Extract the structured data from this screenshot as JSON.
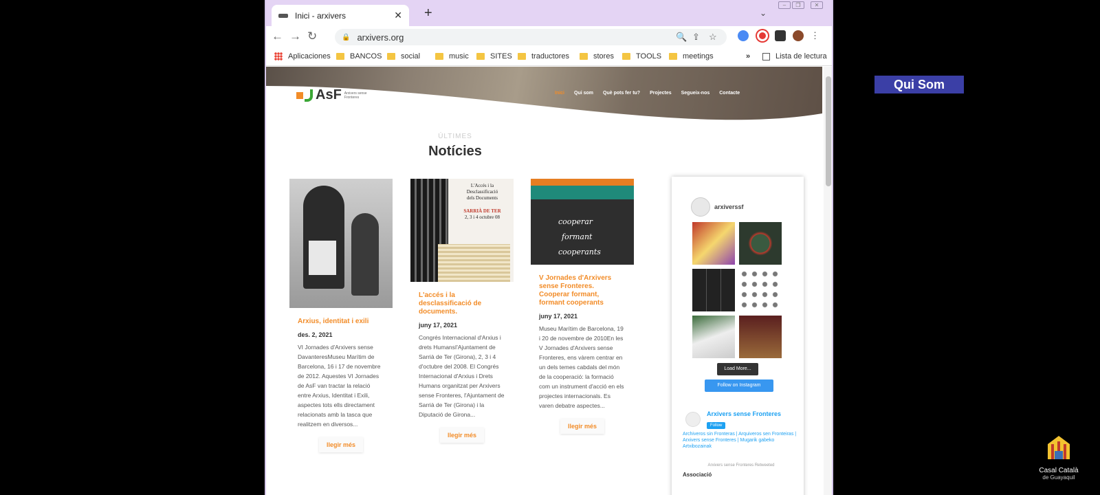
{
  "browser": {
    "tab_title": "Inici - arxivers",
    "new_tab_icon": "plus-icon",
    "url": "arxivers.org",
    "bookmarks": [
      "Aplicaciones",
      "BANCOS",
      "social",
      "music",
      "SITES",
      "traductores",
      "stores",
      "TOOLS",
      "meetings"
    ],
    "reading_list": "Lista de lectura",
    "overflow": "»"
  },
  "site": {
    "logo_text": "AsF",
    "logo_sub": "Arxivers sense Fronteres",
    "nav": [
      "Inici",
      "Qui som",
      "Què pots fer tu?",
      "Projectes",
      "Segueix-nos",
      "Contacte"
    ],
    "eyebrow": "ÚLTIMES",
    "section_title": "Notícies",
    "cards": [
      {
        "title": "Arxius, identitat i exili",
        "date": "des. 2, 2021",
        "excerpt": "VI Jornades d'Arxivers sense DavanteresMuseu Marítim de Barcelona, 16 i 17 de novembre de 2012. Aquestes VI Jornades de AsF van tractar la relació entre Arxius, Identitat i Exili, aspectes tots ells directament relacionats amb la tasca que realitzem en diversos...",
        "more": "llegir més"
      },
      {
        "title": "L'accés i la desclassificació de documents.",
        "date": "juny 17, 2021",
        "excerpt": "Congrés Internacional d'Arxius i drets HumansI'Ajuntament de Sarrià de Ter (Girona), 2, 3 i 4 d'octubre del 2008. El Congrés Internacional d'Arxius i Drets Humans organitzat per Arxivers sense Fronteres, l'Ajuntament de Sarrià de Ter (Girona) i la Diputació de Girona...",
        "more": "llegir més"
      },
      {
        "title": "V Jornades d'Arxivers sense Fronteres. Cooperar formant, formant cooperants",
        "date": "juny 17, 2021",
        "excerpt": "Museu Marítim de Barcelona, 19 i 20 de novembre de 2010En les V Jornades d'Arxivers sense Fronteres, ens vàrem centrar en un dels temes cabdals del món de la cooperació: la formació com un instrument d'acció en els projectes internacionals. Es varen debatre aspectes...",
        "more": "llegir més"
      }
    ],
    "card2_image_text": [
      "L'Accés i la",
      "Desclassificació",
      "dels Documents",
      "SARRIÀ DE TER",
      "2, 3 i 4 octubre 08"
    ],
    "card3_image_text": [
      "cooperar",
      "formant",
      "cooperants"
    ],
    "instagram": {
      "user": "arxiverssf",
      "load_more": "Load More...",
      "follow": "Follow on Instagram"
    },
    "twitter": {
      "name": "Arxivers sense Fronteres",
      "follow": "Follow",
      "desc": "Archiveros sin Fronteras | Arquiveros sen Fronteiras | Arxivers sense Fronteres | Mugarik gabeko Artxibozainak",
      "retweeted": "Arxivers sense Fronteres Retweeted",
      "next": "Associació"
    }
  },
  "overlay": {
    "label": "Qui Som",
    "brand_line1": "Casal Català",
    "brand_line2": "de Guayaquil"
  }
}
